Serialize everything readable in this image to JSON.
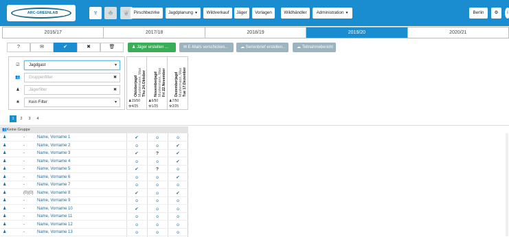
{
  "header": {
    "logo_text": "ARC-GREENLAB",
    "icons": [
      "deer-icon",
      "tree-icon",
      "leaf-icon"
    ],
    "nav": [
      "Pirschbezirke",
      "Jagdplanung",
      "Wildverkauf",
      "Jäger",
      "Vorlagen",
      "Wildhändler",
      "Administration"
    ],
    "user": "Berlin"
  },
  "years": [
    "2016/17",
    "2017/18",
    "2018/19",
    "2019/20",
    "2020/21"
  ],
  "active_year": "2019/20",
  "tools": [
    "?",
    "✉",
    "✔",
    "✖",
    "🗑"
  ],
  "actions": {
    "add_hunter": "Jäger erstellen ...",
    "send_email": "E-Mails verschicken...",
    "serial_letter": "Serienbrief erstellen...",
    "report": "Teilnahmebericht"
  },
  "filters": {
    "type": "Jagdgast",
    "group_placeholder": "Gruppenfilter",
    "hunter_placeholder": "Jägerfilter",
    "none": "Kein Filter"
  },
  "hunts": [
    {
      "name": "Oktoberjagd",
      "organizer": "Mustermann, Max",
      "date": "Thu 24.Oktober",
      "count1": "15/50",
      "count2": "4/25"
    },
    {
      "name": "Novemberjagd",
      "organizer": "Mustermann, Max",
      "date": "Fri 22.November",
      "count1": "6/50",
      "count2": "1/25"
    },
    {
      "name": "Dezemberjagd",
      "organizer": "Mustermann, Max",
      "date": "Tue 17.Dezember",
      "count1": "7/50",
      "count2": "2/25"
    }
  ],
  "pages": [
    "1",
    "2",
    "3",
    "4"
  ],
  "group_label": "Keine Gruppe",
  "rows": [
    {
      "badge": "-",
      "name": "Name, Vorname 1",
      "cells": [
        "yes",
        "no",
        "no"
      ]
    },
    {
      "badge": "-",
      "name": "Name, Vorname 2",
      "cells": [
        "no",
        "no",
        "yes"
      ]
    },
    {
      "badge": "-",
      "name": "Name, Vorname 3",
      "cells": [
        "yes",
        "q",
        "yes"
      ]
    },
    {
      "badge": "-",
      "name": "Name, Vorname 4",
      "cells": [
        "no",
        "no",
        "yes"
      ]
    },
    {
      "badge": "-",
      "name": "Name, Vorname 5",
      "cells": [
        "yes",
        "q",
        "no"
      ]
    },
    {
      "badge": "-",
      "name": "Name, Vorname 6",
      "cells": [
        "no",
        "no",
        "yes"
      ]
    },
    {
      "badge": "-",
      "name": "Name, Vorname 7",
      "cells": [
        "no",
        "no",
        "no"
      ]
    },
    {
      "badge": "(0)(0)",
      "name": "Name, Vorname 8",
      "cells": [
        "yes",
        "no",
        "yes"
      ]
    },
    {
      "badge": "-",
      "name": "Name, Vorname 9",
      "cells": [
        "no",
        "no",
        "no"
      ]
    },
    {
      "badge": "-",
      "name": "Name, Vorname 10",
      "cells": [
        "yes",
        "no",
        "no"
      ]
    },
    {
      "badge": "-",
      "name": "Name, Vorname 11",
      "cells": [
        "no",
        "no",
        "no"
      ]
    },
    {
      "badge": "-",
      "name": "Name, Vorname 12",
      "cells": [
        "no",
        "no",
        "no"
      ]
    },
    {
      "badge": "-",
      "name": "Name, Vorname 13",
      "cells": [
        "no",
        "no",
        "no"
      ]
    }
  ]
}
